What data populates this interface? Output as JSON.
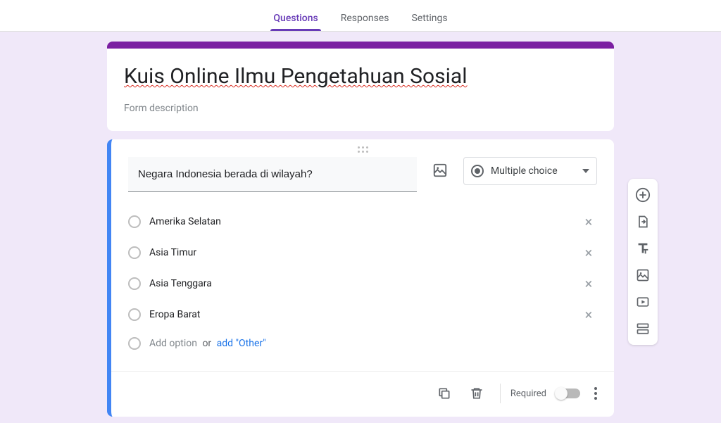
{
  "tabs": {
    "questions": "Questions",
    "responses": "Responses",
    "settings": "Settings"
  },
  "header": {
    "title": "Kuis Online Ilmu Pengetahuan Sosial",
    "description": "Form description"
  },
  "question": {
    "text": "Negara Indonesia berada di wilayah?",
    "type_label": "Multiple choice",
    "options": [
      "Amerika Selatan",
      "Asia Timur",
      "Asia Tenggara",
      "Eropa Barat"
    ],
    "add_option": "Add option",
    "or": "or",
    "add_other": "add \"Other\""
  },
  "footer": {
    "required": "Required"
  }
}
